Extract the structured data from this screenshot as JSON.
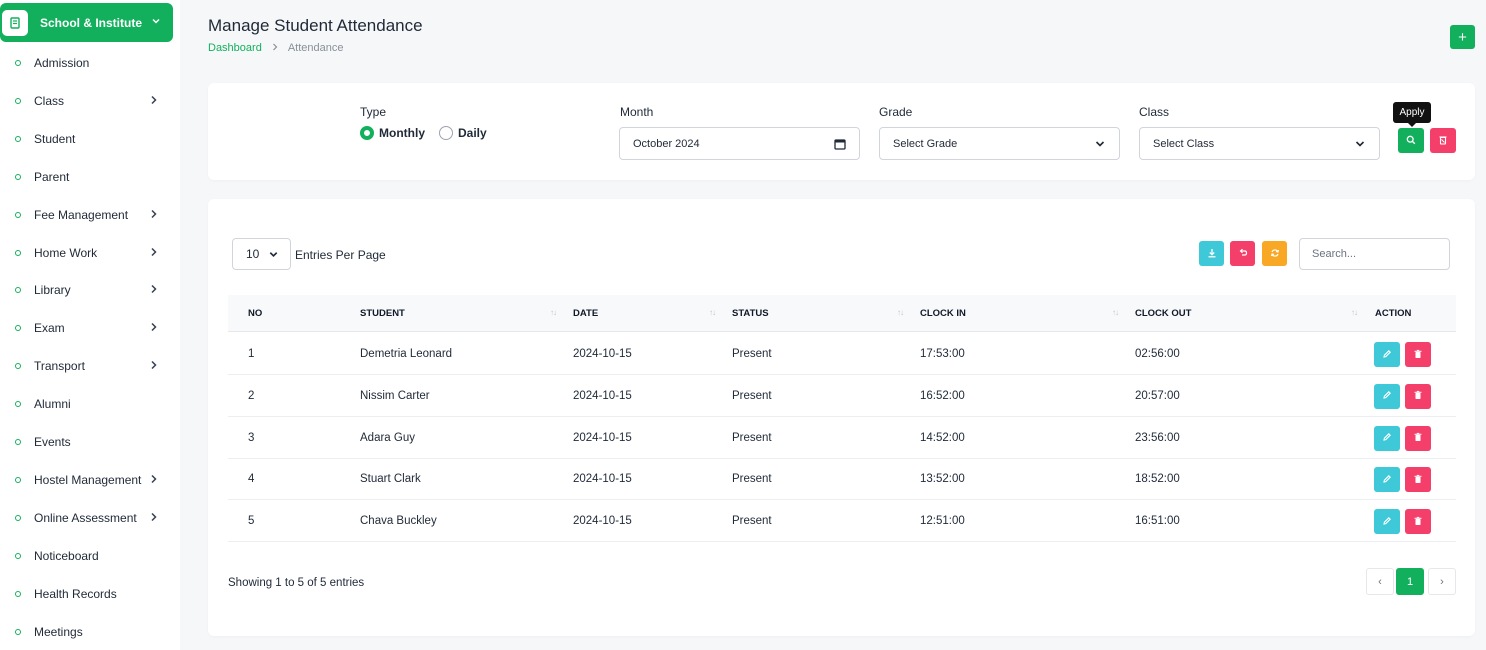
{
  "sidebar": {
    "brand": "School & Institute",
    "items": [
      {
        "label": "Admission",
        "chevron": false
      },
      {
        "label": "Class",
        "chevron": true
      },
      {
        "label": "Student",
        "chevron": false
      },
      {
        "label": "Parent",
        "chevron": false
      },
      {
        "label": "Fee Management",
        "chevron": true
      },
      {
        "label": "Home Work",
        "chevron": true
      },
      {
        "label": "Library",
        "chevron": true
      },
      {
        "label": "Exam",
        "chevron": true
      },
      {
        "label": "Transport",
        "chevron": true
      },
      {
        "label": "Alumni",
        "chevron": false
      },
      {
        "label": "Events",
        "chevron": false
      },
      {
        "label": "Hostel Management",
        "chevron": true
      },
      {
        "label": "Online Assessment",
        "chevron": true
      },
      {
        "label": "Noticeboard",
        "chevron": false
      },
      {
        "label": "Health Records",
        "chevron": false
      },
      {
        "label": "Meetings",
        "chevron": false
      }
    ]
  },
  "header": {
    "title": "Manage Student Attendance",
    "breadcrumb": {
      "home": "Dashboard",
      "current": "Attendance"
    },
    "add_label": "+"
  },
  "filters": {
    "type_label": "Type",
    "type_options": [
      {
        "label": "Monthly",
        "checked": true
      },
      {
        "label": "Daily",
        "checked": false
      }
    ],
    "month_label": "Month",
    "month_value": "October 2024",
    "grade_label": "Grade",
    "grade_value": "Select Grade",
    "class_label": "Class",
    "class_value": "Select Class",
    "apply_tooltip": "Apply"
  },
  "table": {
    "entries_value": "10",
    "entries_label": "Entries Per Page",
    "search_placeholder": "Search...",
    "columns": [
      "NO",
      "STUDENT",
      "DATE",
      "STATUS",
      "CLOCK IN",
      "CLOCK OUT",
      "ACTION"
    ],
    "rows": [
      {
        "no": "1",
        "student": "Demetria Leonard",
        "date": "2024-10-15",
        "status": "Present",
        "clock_in": "17:53:00",
        "clock_out": "02:56:00"
      },
      {
        "no": "2",
        "student": "Nissim Carter",
        "date": "2024-10-15",
        "status": "Present",
        "clock_in": "16:52:00",
        "clock_out": "20:57:00"
      },
      {
        "no": "3",
        "student": "Adara Guy",
        "date": "2024-10-15",
        "status": "Present",
        "clock_in": "14:52:00",
        "clock_out": "23:56:00"
      },
      {
        "no": "4",
        "student": "Stuart Clark",
        "date": "2024-10-15",
        "status": "Present",
        "clock_in": "13:52:00",
        "clock_out": "18:52:00"
      },
      {
        "no": "5",
        "student": "Chava Buckley",
        "date": "2024-10-15",
        "status": "Present",
        "clock_in": "12:51:00",
        "clock_out": "16:51:00"
      }
    ],
    "showing": "Showing 1 to 5 of 5 entries",
    "pagination": {
      "prev": "‹",
      "current": "1",
      "next": "›"
    }
  },
  "icons": {
    "brand": "book-icon",
    "download": "download-icon",
    "undo": "undo-icon",
    "refresh": "refresh-icon",
    "search": "search-icon",
    "clear": "trash-filter-icon",
    "edit": "pencil-icon",
    "delete": "trash-icon"
  },
  "colors": {
    "primary": "#12b05c",
    "danger": "#f43f6b",
    "info": "#3ec8d8",
    "warning": "#f9a825"
  }
}
